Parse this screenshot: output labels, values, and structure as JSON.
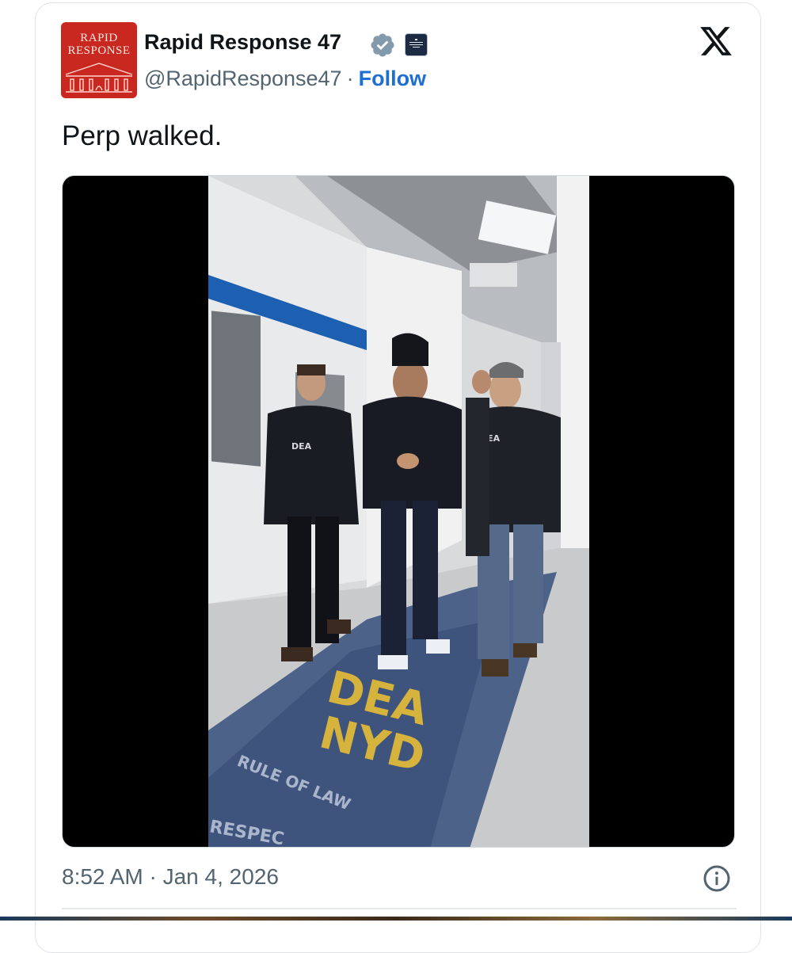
{
  "account": {
    "display_name": "Rapid Response 47",
    "handle": "@RapidResponse47",
    "separator": "·",
    "follow_label": "Follow",
    "avatar_text_line1": "RAPID",
    "avatar_text_line2": "RESPONSE",
    "avatar_color": "#c8281f",
    "verified_icon": "verified-badge-icon",
    "affiliation_icon": "white-house-affiliation-icon",
    "affiliation_text": "WHITE HOUSE"
  },
  "brand_icon": "x-logo-icon",
  "tweet": {
    "text": "Perp walked.",
    "timestamp": "8:52 AM · Jan 4, 2026",
    "info_icon": "info-icon"
  },
  "media": {
    "type": "video",
    "floor_text_line1": "DEA",
    "floor_text_line2": "NYD",
    "floor_text_line3": "RULE OF LAW",
    "floor_text_line4": "RESPEC",
    "jacket_text": "DEA"
  },
  "colors": {
    "link": "#1d6fd1",
    "text": "#0f1419",
    "muted": "#536471",
    "verified": "#829aab"
  }
}
